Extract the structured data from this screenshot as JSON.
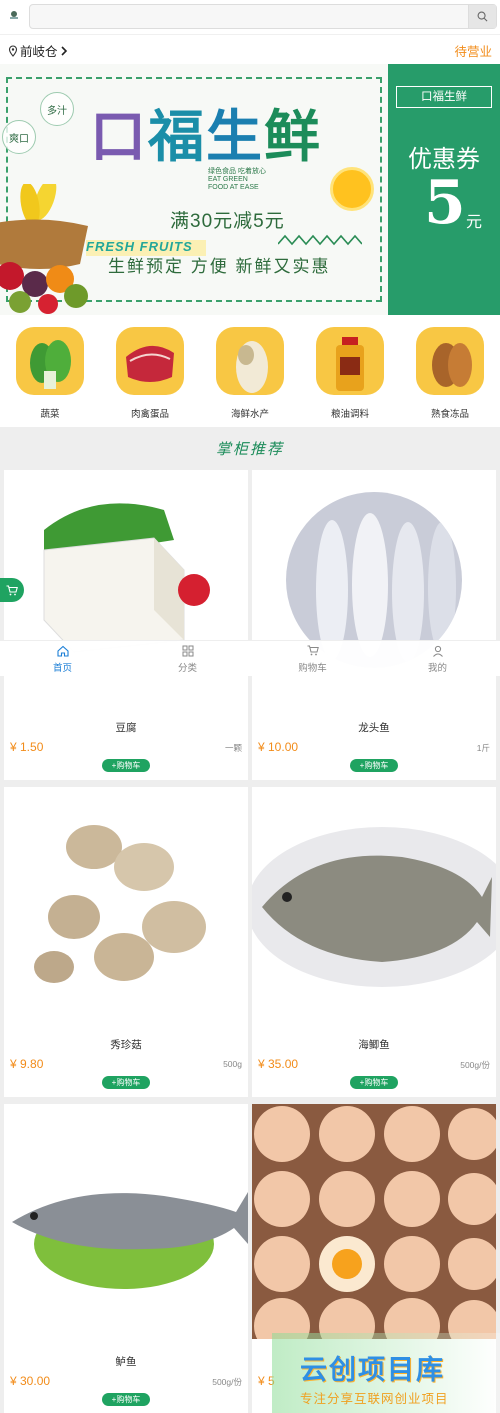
{
  "header": {
    "search_placeholder": "",
    "location": "前岐仓",
    "status": "待营业"
  },
  "banner": {
    "title_chars": [
      "口",
      "福",
      "生",
      "鲜"
    ],
    "eat_green": "绿色食品 吃着放心 EAT GREEN FOOD AT EASE",
    "fresh_fruits": "FRESH FRUITS",
    "promo": "满30元减5元",
    "slogan": "生鲜预定  方便 新鲜又实惠",
    "bubble_1": "多汁",
    "bubble_2": "爽口",
    "coupon_tag": "口福生鲜",
    "coupon_label": "优惠券",
    "coupon_value": "5",
    "coupon_unit": "元"
  },
  "categories": [
    {
      "label": "蔬菜",
      "icon": "vegetable-icon"
    },
    {
      "label": "肉禽蛋品",
      "icon": "meat-icon"
    },
    {
      "label": "海鲜水产",
      "icon": "fish-icon"
    },
    {
      "label": "粮油调料",
      "icon": "oil-icon"
    },
    {
      "label": "熟食冻品",
      "icon": "cooked-food-icon"
    }
  ],
  "section_title": "掌柜推荐",
  "products": [
    {
      "name": "豆腐",
      "price": "¥ 1.50",
      "unit": "一颗",
      "cart": "+购物车"
    },
    {
      "name": "龙头鱼",
      "price": "¥ 10.00",
      "unit": "1斤",
      "cart": "+购物车"
    },
    {
      "name": "秀珍菇",
      "price": "¥ 9.80",
      "unit": "500g",
      "cart": "+购物车"
    },
    {
      "name": "海鲫鱼",
      "price": "¥ 35.00",
      "unit": "500g/份",
      "cart": "+购物车"
    },
    {
      "name": "鲈鱼",
      "price": "¥ 30.00",
      "unit": "500g/份",
      "cart": "+购物车"
    },
    {
      "name": "",
      "price": "¥ 5",
      "unit": "",
      "cart": ""
    }
  ],
  "tabbar": [
    {
      "label": "首页",
      "icon": "home-icon",
      "active": true
    },
    {
      "label": "分类",
      "icon": "grid-icon",
      "active": false
    },
    {
      "label": "购物车",
      "icon": "cart-icon",
      "active": false
    },
    {
      "label": "我的",
      "icon": "user-icon",
      "active": false
    }
  ],
  "watermark": {
    "title": "云创项目库",
    "subtitle": "专注分享互联网创业项目"
  },
  "colors": {
    "brand_green": "#1fa361",
    "price_orange": "#f28c1a",
    "active_blue": "#1c7fd6"
  }
}
